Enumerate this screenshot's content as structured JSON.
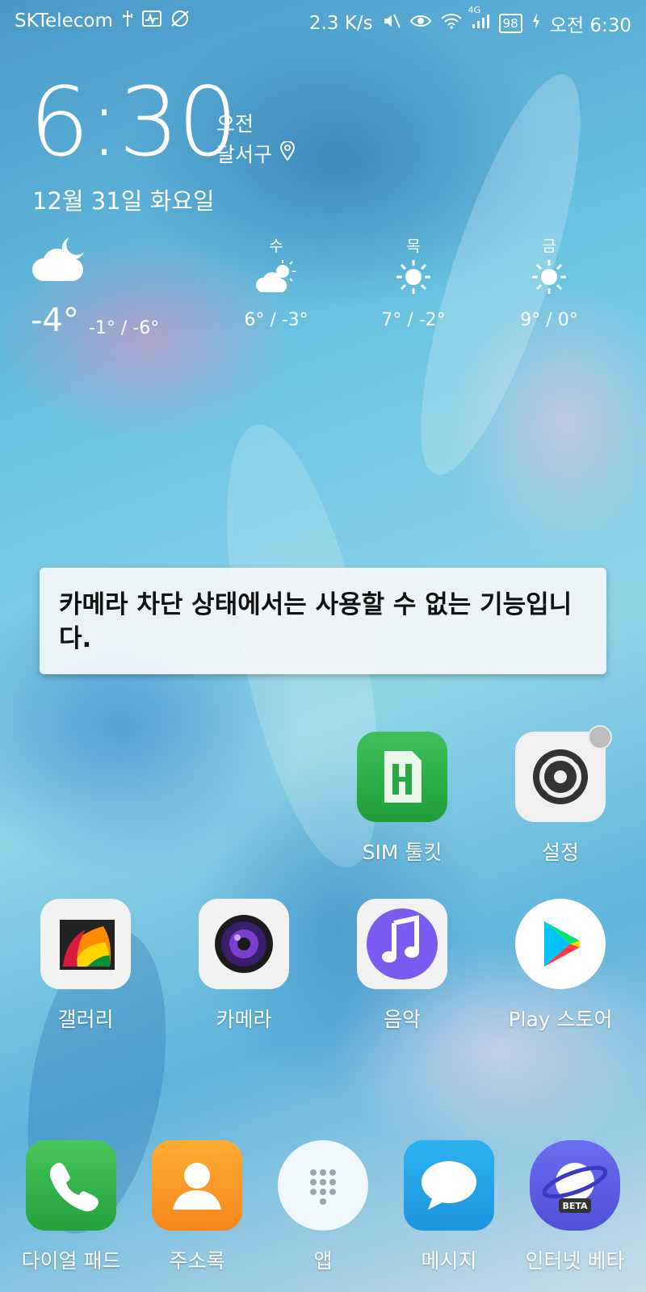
{
  "status_bar": {
    "carrier": "SKTelecom",
    "speed": "2.3 K/s",
    "network": "4G",
    "battery": "98",
    "time": "오전 6:30"
  },
  "clock": {
    "time": "6:30",
    "ampm": "오전",
    "location": "달서구",
    "date": "12월 31일 화요일"
  },
  "weather": {
    "current_temp": "-4°",
    "current_range": "-1° / -6°",
    "forecast": [
      {
        "day": "수",
        "range": "6° / -3°",
        "icon": "partly-cloudy-icon"
      },
      {
        "day": "목",
        "range": "7° / -2°",
        "icon": "sun-icon"
      },
      {
        "day": "금",
        "range": "9° / 0°",
        "icon": "sun-icon"
      }
    ]
  },
  "toast": {
    "message": "카메라 차단 상태에서는 사용할 수 없는 기능입니다."
  },
  "apps": {
    "sim": "SIM 툴킷",
    "settings": "설정",
    "gallery": "갤러리",
    "camera": "카메라",
    "music": "음악",
    "play": "Play 스토어"
  },
  "dock": {
    "phone": "다이얼 패드",
    "contacts": "주소록",
    "apps": "앱",
    "messages": "메시지",
    "internet": "인터넷 베타",
    "internet_badge": "BETA"
  }
}
